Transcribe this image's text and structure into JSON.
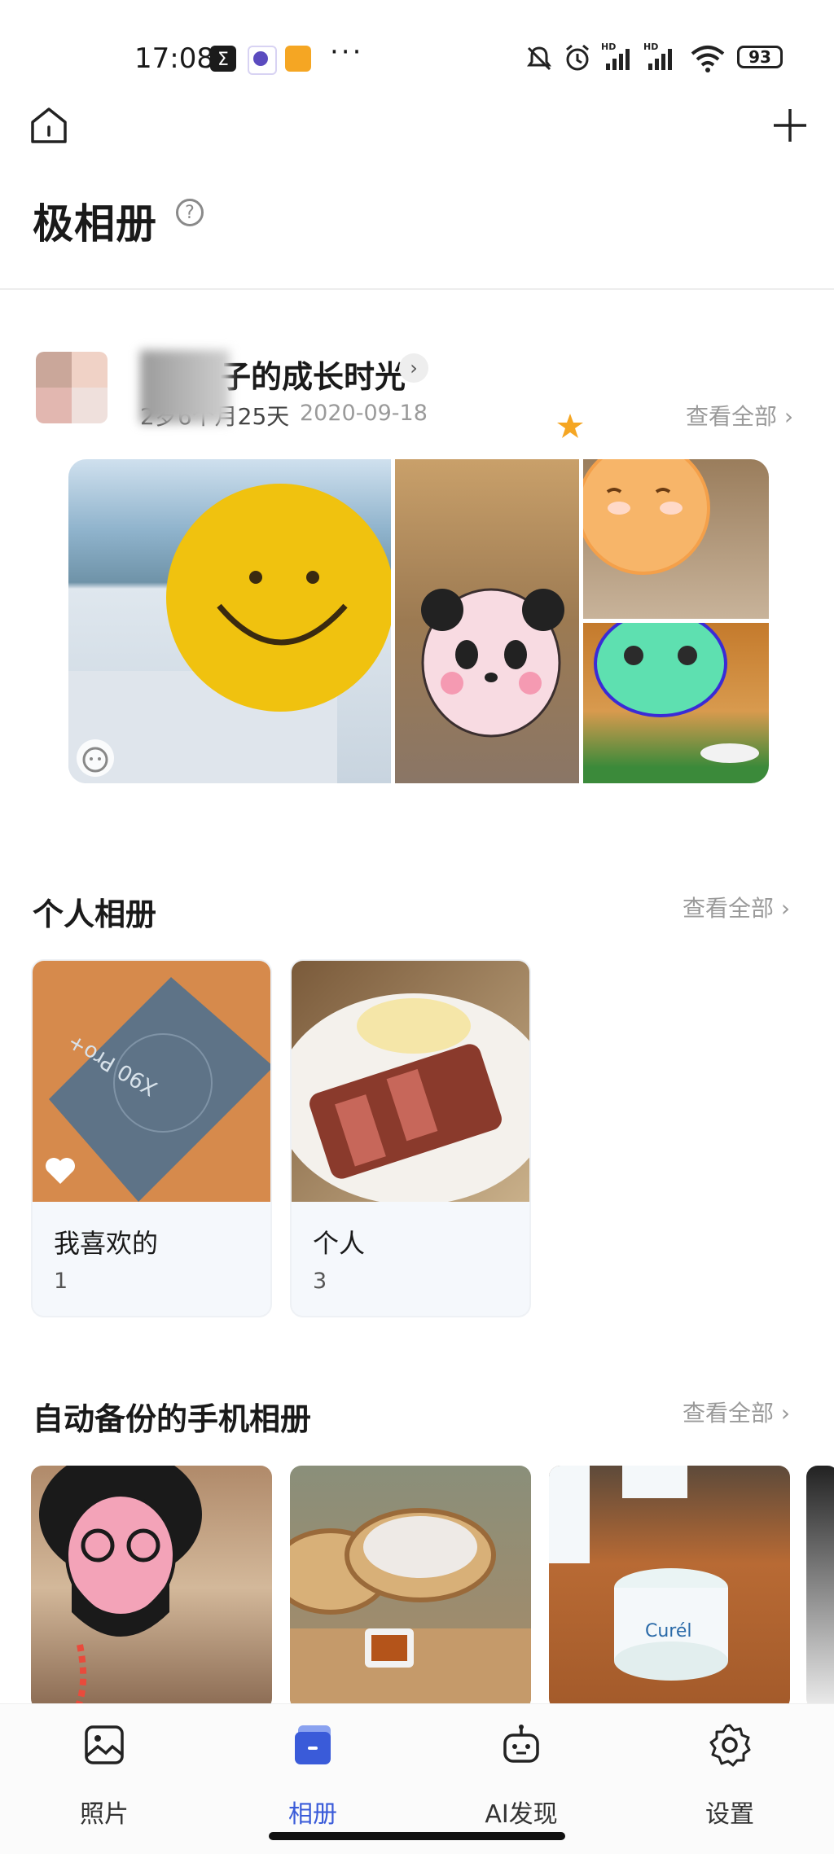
{
  "status_bar": {
    "time": "17:08",
    "battery": "93"
  },
  "header": {
    "title": "极相册",
    "help": "?"
  },
  "growth": {
    "title": "子的成长时光",
    "age": "2岁6个月25天",
    "date": "2020-09-18",
    "see_all": "查看全部 ›"
  },
  "personal_albums": {
    "title": "个人相册",
    "see_all": "查看全部 ›",
    "albums": [
      {
        "name": "我喜欢的",
        "count": "1"
      },
      {
        "name": "个人",
        "count": "3"
      }
    ]
  },
  "backup_albums": {
    "title": "自动备份的手机相册",
    "see_all": "查看全部 ›"
  },
  "bottom_nav": {
    "items": [
      {
        "label": "照片",
        "icon": "photo-icon"
      },
      {
        "label": "相册",
        "icon": "album-icon",
        "active": true
      },
      {
        "label": "AI发现",
        "icon": "robot-icon"
      },
      {
        "label": "设置",
        "icon": "gear-icon"
      }
    ]
  },
  "colors": {
    "accent": "#3a5bd9",
    "muted": "#9a9a9a"
  }
}
